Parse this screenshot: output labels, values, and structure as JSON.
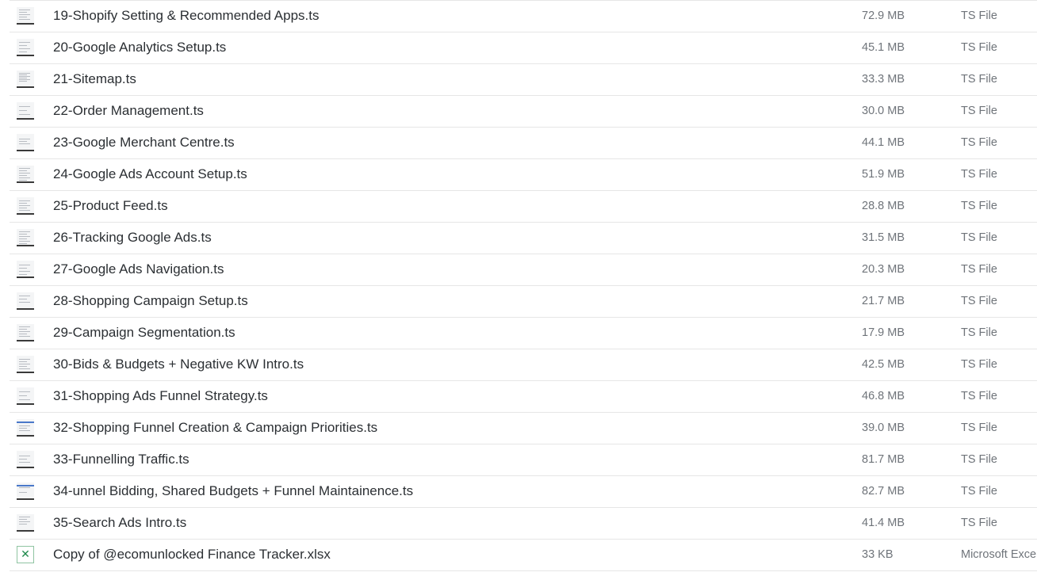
{
  "files": [
    {
      "name": "19-Shopify Setting & Recommended Apps.ts",
      "size": "72.9 MB",
      "type": "TS File",
      "icon": "video-thumbnail-icon"
    },
    {
      "name": "20-Google Analytics Setup.ts",
      "size": "45.1 MB",
      "type": "TS File",
      "icon": "video-thumbnail-icon"
    },
    {
      "name": "21-Sitemap.ts",
      "size": "33.3 MB",
      "type": "TS File",
      "icon": "video-thumbnail-icon"
    },
    {
      "name": "22-Order Management.ts",
      "size": "30.0 MB",
      "type": "TS File",
      "icon": "video-thumbnail-icon"
    },
    {
      "name": "23-Google Merchant Centre.ts",
      "size": "44.1 MB",
      "type": "TS File",
      "icon": "video-thumbnail-icon"
    },
    {
      "name": "24-Google Ads Account Setup.ts",
      "size": "51.9 MB",
      "type": "TS File",
      "icon": "video-thumbnail-icon"
    },
    {
      "name": "25-Product Feed.ts",
      "size": "28.8 MB",
      "type": "TS File",
      "icon": "video-thumbnail-icon"
    },
    {
      "name": "26-Tracking Google Ads.ts",
      "size": "31.5 MB",
      "type": "TS File",
      "icon": "video-thumbnail-icon"
    },
    {
      "name": "27-Google Ads Navigation.ts",
      "size": "20.3 MB",
      "type": "TS File",
      "icon": "video-thumbnail-icon"
    },
    {
      "name": "28-Shopping Campaign Setup.ts",
      "size": "21.7 MB",
      "type": "TS File",
      "icon": "video-thumbnail-icon"
    },
    {
      "name": "29-Campaign Segmentation.ts",
      "size": "17.9 MB",
      "type": "TS File",
      "icon": "video-thumbnail-icon"
    },
    {
      "name": "30-Bids & Budgets + Negative KW Intro.ts",
      "size": "42.5 MB",
      "type": "TS File",
      "icon": "video-thumbnail-icon"
    },
    {
      "name": "31-Shopping Ads Funnel Strategy.ts",
      "size": "46.8 MB",
      "type": "TS File",
      "icon": "video-thumbnail-icon"
    },
    {
      "name": "32-Shopping Funnel Creation & Campaign Priorities.ts",
      "size": "39.0 MB",
      "type": "TS File",
      "icon": "video-thumbnail-icon"
    },
    {
      "name": "33-Funnelling Traffic.ts",
      "size": "81.7 MB",
      "type": "TS File",
      "icon": "video-thumbnail-icon"
    },
    {
      "name": "34-unnel Bidding, Shared Budgets + Funnel Maintainence.ts",
      "size": "82.7 MB",
      "type": "TS File",
      "icon": "video-thumbnail-icon"
    },
    {
      "name": "35-Search Ads Intro.ts",
      "size": "41.4 MB",
      "type": "TS File",
      "icon": "video-thumbnail-icon"
    },
    {
      "name": "Copy of @ecomunlocked Finance Tracker.xlsx",
      "size": "33 KB",
      "type": "Microsoft Excel",
      "icon": "excel-file-icon"
    }
  ],
  "colors": {
    "name_text": "#2b2f33",
    "meta_text": "#6f747a",
    "row_divider": "#e6e6e6",
    "excel_green": "#1f8a4c"
  }
}
